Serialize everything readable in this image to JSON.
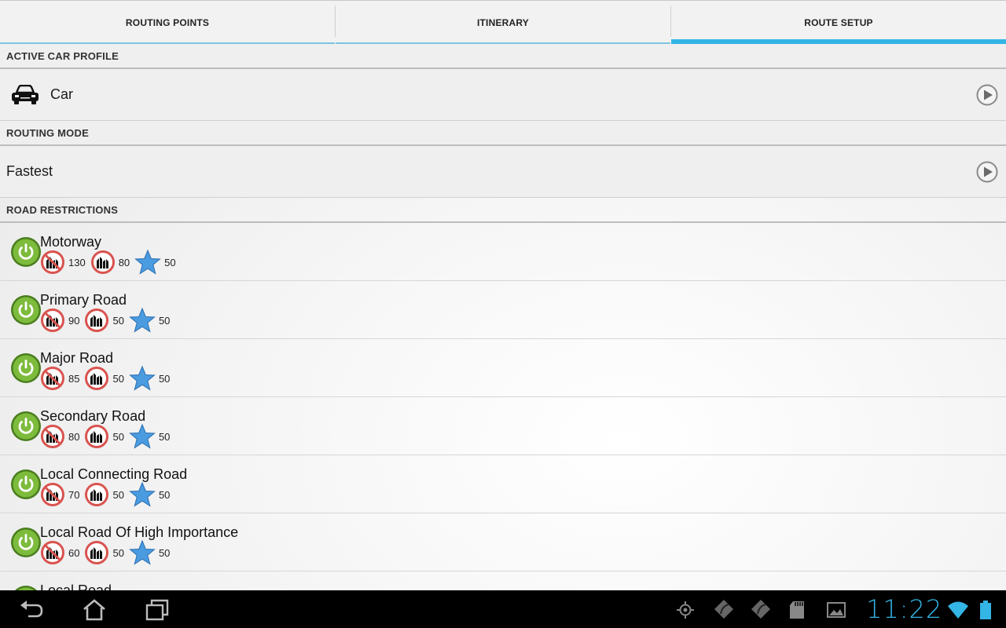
{
  "tabs": [
    {
      "label": "ROUTING POINTS",
      "active": false
    },
    {
      "label": "ITINERARY",
      "active": false
    },
    {
      "label": "ROUTE SETUP",
      "active": true
    }
  ],
  "sections": {
    "car_profile": {
      "header": "ACTIVE CAR PROFILE",
      "value": "Car",
      "icon": "car-icon",
      "action_icon": "arrow-right-icon"
    },
    "routing_mode": {
      "header": "ROUTING MODE",
      "value": "Fastest",
      "action_icon": "arrow-right-icon"
    },
    "road_restrictions": {
      "header": "ROAD RESTRICTIONS"
    }
  },
  "roads": [
    {
      "name": "Motorway",
      "speed_limit": "130",
      "speed_min": "80",
      "priority": "50"
    },
    {
      "name": "Primary Road",
      "speed_limit": "90",
      "speed_min": "50",
      "priority": "50"
    },
    {
      "name": "Major Road",
      "speed_limit": "85",
      "speed_min": "50",
      "priority": "50"
    },
    {
      "name": "Secondary Road",
      "speed_limit": "80",
      "speed_min": "50",
      "priority": "50"
    },
    {
      "name": "Local Connecting Road",
      "speed_limit": "70",
      "speed_min": "50",
      "priority": "50"
    },
    {
      "name": "Local Road Of High Importance",
      "speed_limit": "60",
      "speed_min": "50",
      "priority": "50"
    },
    {
      "name": "Local Road",
      "speed_limit": "",
      "speed_min": "",
      "priority": ""
    }
  ],
  "status_bar": {
    "time": "11:22",
    "icons": [
      "gps-icon",
      "navigation-app-icon",
      "navigation-app-icon",
      "sd-card-icon",
      "gallery-icon",
      "wifi-icon",
      "battery-icon"
    ]
  },
  "colors": {
    "accent": "#33b5e5",
    "power_green": "#6db33f",
    "no_sign_red": "#d9534f",
    "star_blue": "#3d8fd6"
  }
}
